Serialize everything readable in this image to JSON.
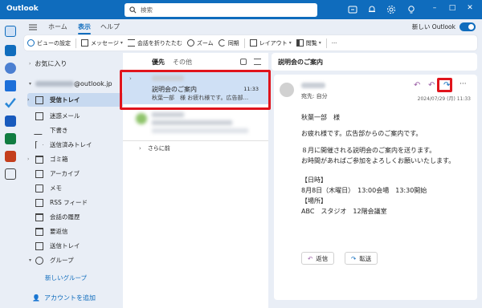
{
  "app": {
    "title": "Outlook"
  },
  "search": {
    "placeholder": "検索"
  },
  "ribbon": {
    "tabs": [
      {
        "label": "ホーム"
      },
      {
        "label": "表示"
      },
      {
        "label": "ヘルプ"
      }
    ],
    "new_outlook_label": "新しい Outlook",
    "new_outlook_enabled": true
  },
  "toolbar": {
    "view_settings": "ビューの設定",
    "message": "メッセージ",
    "collapse": "会話を折りたたむ",
    "zoom": "ズーム",
    "sync": "同期",
    "layout": "レイアウト",
    "reading_pane": "閲覧",
    "more": "···"
  },
  "folders": {
    "favorites_label": "お気に入り",
    "account_suffix": "@outlook.jp",
    "items": [
      {
        "label": "受信トレイ",
        "icon": "inbox-icon"
      },
      {
        "label": "迷惑メール",
        "icon": "junk-icon"
      },
      {
        "label": "下書き",
        "icon": "draft-icon"
      },
      {
        "label": "送信済みトレイ",
        "icon": "sent-icon"
      },
      {
        "label": "ゴミ箱",
        "icon": "trash-icon"
      },
      {
        "label": "アーカイブ",
        "icon": "archive-icon"
      },
      {
        "label": "メモ",
        "icon": "note-icon"
      },
      {
        "label": "RSS フィード",
        "icon": "rss-icon"
      },
      {
        "label": "会話の履歴",
        "icon": "folder-icon"
      },
      {
        "label": "要返信",
        "icon": "folder-icon"
      },
      {
        "label": "送信トレイ",
        "icon": "outbox-icon"
      },
      {
        "label": "グループ",
        "icon": "group-icon"
      }
    ],
    "new_group": "新しいグループ",
    "add_account": "アカウントを追加"
  },
  "list": {
    "tab_focused": "優先",
    "tab_other": "その他",
    "selected_item": {
      "subject": "説明会のご案内",
      "time": "11:33",
      "preview": "秋葉一部　様 お疲れ様です。広告部..."
    },
    "more_label": "さらに前"
  },
  "reading": {
    "subject": "説明会のご案内",
    "to_label": "宛先: 自分",
    "datetime": "2024/07/29 (月) 11:33",
    "body": [
      "秋葉一部　様",
      "",
      "お疲れ様です。広告部からのご案内です。",
      "",
      "８月に開催される説明会のご案内を送ります。",
      "お時間があればご参加をよろしくお願いいたします。",
      "",
      "【日時】",
      "8月8日（木曜日）　13:00会場　13:30開始",
      "【場所】",
      "ABC　スタジオ　12階会議室"
    ],
    "reply": "返信",
    "forward": "転送"
  },
  "colors": {
    "accent": "#0f6cbd",
    "highlight": "#e0141c"
  }
}
